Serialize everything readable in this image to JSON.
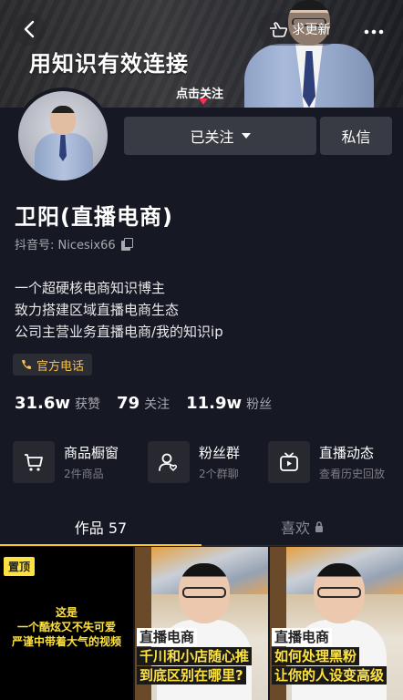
{
  "banner": {
    "slogan": "用知识有效连接",
    "follow_hint": "点击关注",
    "urge_update_label": "求更新"
  },
  "profile": {
    "follow_label": "已关注",
    "message_label": "私信",
    "name": "卫阳(直播电商)",
    "douyin_id": "抖音号: Nicesix66",
    "bio": [
      "一个超硬核电商知识博主",
      "致力搭建区域直播电商生态",
      "公司主营业务直播电商/我的知识ip"
    ],
    "phone_tag": "官方电话"
  },
  "stats": [
    {
      "value": "31.6w",
      "label": "获赞"
    },
    {
      "value": "79",
      "label": "关注"
    },
    {
      "value": "11.9w",
      "label": "粉丝"
    }
  ],
  "features": [
    {
      "icon": "cart-icon",
      "title": "商品橱窗",
      "subtitle": "2件商品"
    },
    {
      "icon": "fan-group-icon",
      "title": "粉丝群",
      "subtitle": "2个群聊"
    },
    {
      "icon": "live-tv-icon",
      "title": "直播动态",
      "subtitle": "查看历史回放"
    }
  ],
  "tabs": {
    "works_label": "作品 57",
    "likes_label": "喜欢"
  },
  "videos": [
    {
      "pinned_label": "置顶",
      "lines": [
        "这是",
        "一个酷炫又不失可爱",
        "严谨中带着大气的视频"
      ]
    },
    {
      "lines": [
        "直播电商",
        "千川和小店随心推",
        "到底区别在哪里?"
      ]
    },
    {
      "lines": [
        "直播电商",
        "如何处理黑粉",
        "让你的人设变高级"
      ]
    }
  ],
  "colors": {
    "background": "#161823",
    "button": "#393b44",
    "accent_yellow": "#fde23f",
    "phone_text": "#f5c24a",
    "tab_underline": "#f7c528"
  }
}
